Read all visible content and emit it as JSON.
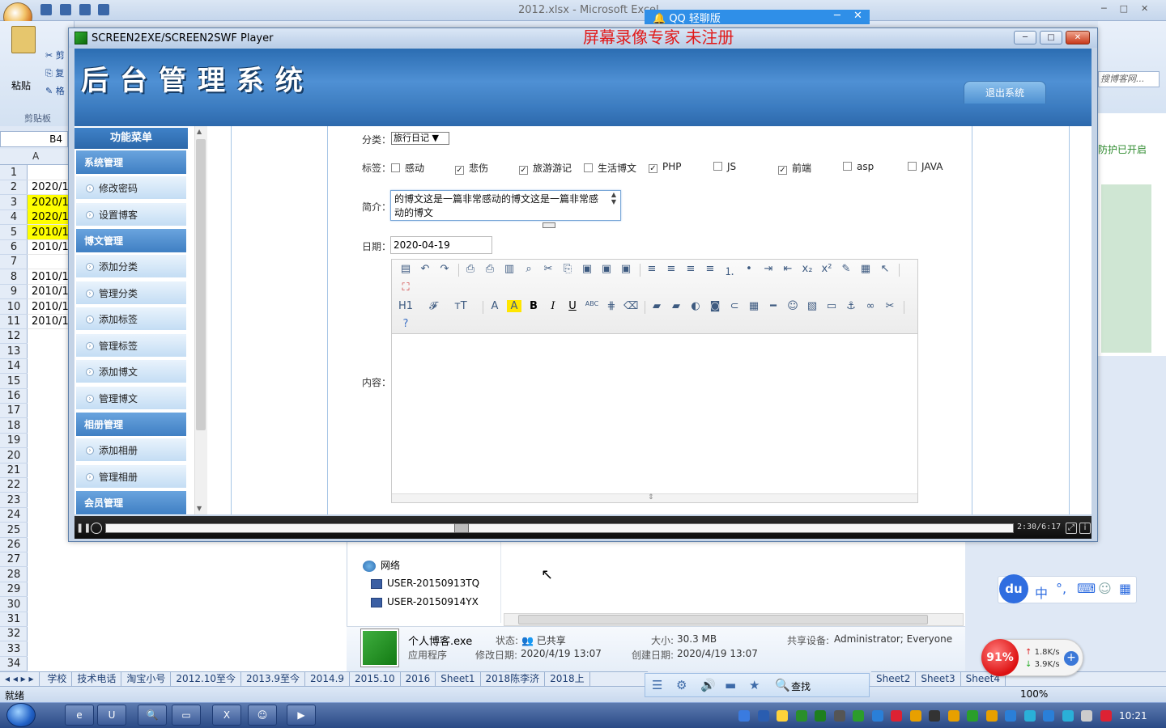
{
  "excel": {
    "title": "2012.xlsx - Microsoft Excel",
    "namebox": "B4",
    "column_header": "A",
    "ribbon": {
      "paste": "粘贴",
      "clipboard": "剪贴板",
      "cut": "剪",
      "copy": "复",
      "format": "格"
    },
    "row_numbers": [
      "1",
      "2",
      "3",
      "4",
      "5",
      "6",
      "7",
      "8",
      "9",
      "10",
      "11",
      "12",
      "13",
      "14",
      "15",
      "16",
      "17",
      "18",
      "19",
      "20",
      "21",
      "22",
      "23",
      "24",
      "25",
      "26",
      "27",
      "28",
      "29",
      "30",
      "31",
      "32",
      "33",
      "34"
    ],
    "cells_a": [
      "",
      "2020/1",
      "2020/1",
      "2020/1",
      "2010/1",
      "2010/1",
      "",
      "2010/1",
      "2010/1",
      "2010/1",
      "2010/1"
    ],
    "sheet_tabs": [
      "学校",
      "技术电话",
      "淘宝小号",
      "2012.10至今",
      "2013.9至今",
      "2014.9",
      "2015.10",
      "2016",
      "Sheet1",
      "2018陈李济",
      "2018上"
    ],
    "sheet_tabs_right": [
      "Sheet2",
      "Sheet3",
      "Sheet4"
    ],
    "status_ready": "就绪",
    "zoom": "100%",
    "right_search_placeholder": "搜博客网...",
    "right_panel_text": "防护已开启"
  },
  "qq": {
    "title": "QQ 轻聊版",
    "search_label": "查找"
  },
  "player": {
    "title": "SCREEN2EXE/SCREEN2SWF Player",
    "watermark": "屏幕录像专家  未注册",
    "time": "2:30/6:17",
    "progress_fraction": 0.39
  },
  "app": {
    "logo": "后台管理系统",
    "logout": "退出系统",
    "sidebar": {
      "title": "功能菜单",
      "sections": [
        {
          "name": "系统管理",
          "items": [
            "修改密码",
            "设置博客"
          ]
        },
        {
          "name": "博文管理",
          "items": [
            "添加分类",
            "管理分类",
            "添加标签",
            "管理标签",
            "添加博文",
            "管理博文"
          ]
        },
        {
          "name": "相册管理",
          "items": [
            "添加相册",
            "管理相册"
          ]
        },
        {
          "name": "会员管理",
          "items": []
        }
      ]
    },
    "form": {
      "category_label": "分类：",
      "category_value": "旅行日记",
      "tags_label": "标签：",
      "tags": [
        {
          "label": "感动",
          "checked": false
        },
        {
          "label": "悲伤",
          "checked": true
        },
        {
          "label": "旅游游记",
          "checked": true
        },
        {
          "label": "生活博文",
          "checked": false
        },
        {
          "label": "PHP",
          "checked": true
        },
        {
          "label": "JS",
          "checked": false
        },
        {
          "label": "前端",
          "checked": true
        },
        {
          "label": "asp",
          "checked": false
        },
        {
          "label": "JAVA",
          "checked": false
        }
      ],
      "intro_label": "简介：",
      "intro_value": "的博文这是一篇非常感动的博文这是一篇非常感动的博文",
      "date_label": "日期：",
      "date_value": "2020-04-19",
      "content_label": "内容："
    }
  },
  "explorer": {
    "tree": [
      "网络",
      "USER-20150913TQ",
      "USER-20150914YX"
    ],
    "file_name": "个人博客.exe",
    "file_type": "应用程序",
    "state_label": "状态:",
    "state_value": "已共享",
    "modified_label": "修改日期:",
    "modified_value": "2020/4/19 13:07",
    "size_label": "大小:",
    "size_value": "30.3 MB",
    "created_label": "创建日期:",
    "created_value": "2020/4/19 13:07",
    "shared_label": "共享设备:",
    "shared_value": "Administrator; Everyone"
  },
  "baidu": {
    "logo": "du",
    "ime": "中"
  },
  "net_meter": {
    "percent": "91%",
    "up": "1.8K/s",
    "down": "3.9K/s"
  },
  "taskbar": {
    "clock": "10:21"
  },
  "colors": {
    "header_blue": "#2b6db2",
    "sidebar_section": "#3f7fc3",
    "watermark_red": "#e11919",
    "highlight_yellow": "#ffff00"
  }
}
